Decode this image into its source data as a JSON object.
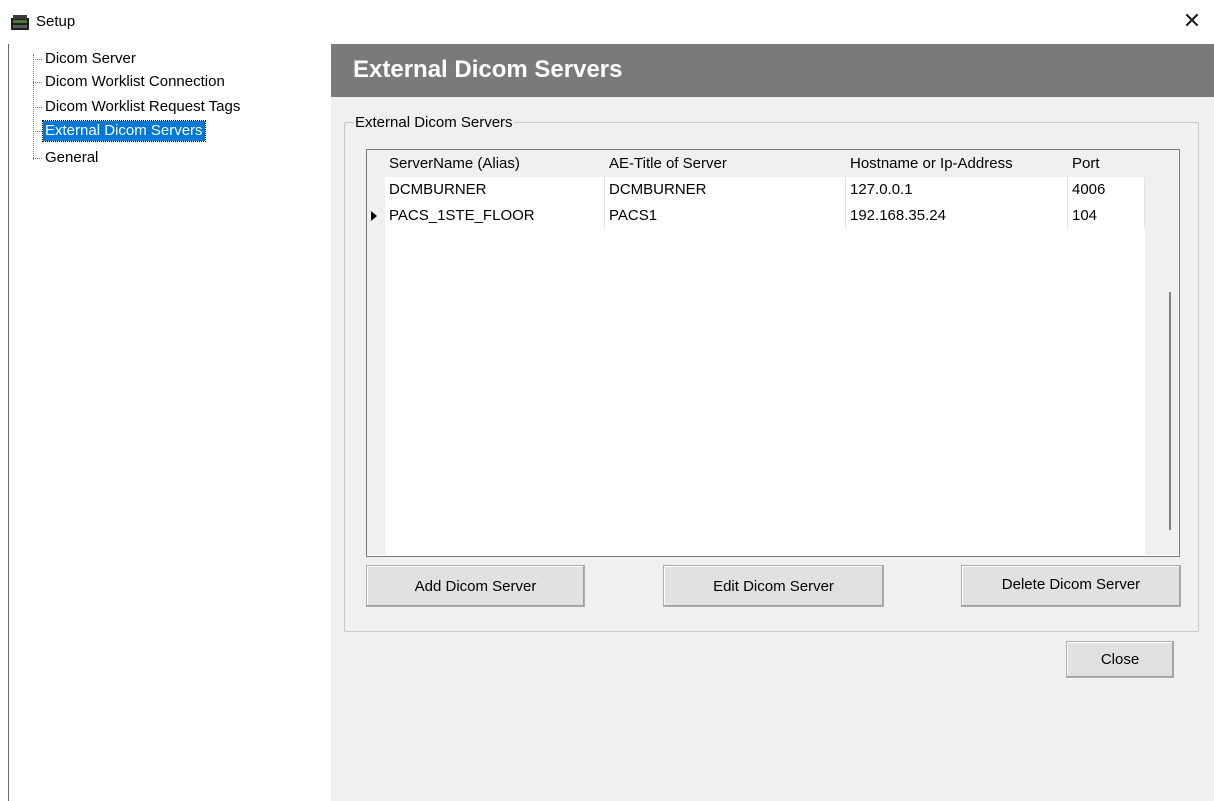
{
  "window": {
    "title": "Setup",
    "close_glyph": "✕"
  },
  "tree": {
    "items": [
      {
        "label": "Dicom Server",
        "selected": false
      },
      {
        "label": "Dicom Worklist Connection",
        "selected": false
      },
      {
        "label": "Dicom Worklist Request Tags",
        "selected": false
      },
      {
        "label": "External Dicom Servers",
        "selected": true
      },
      {
        "label": "General",
        "selected": false
      }
    ]
  },
  "panel": {
    "header_title": "External Dicom Servers",
    "group_title": "External Dicom Servers",
    "table": {
      "columns": [
        "ServerName (Alias)",
        "AE-Title of Server",
        "Hostname or Ip-Address",
        "Port"
      ],
      "rows": [
        [
          "DCMBURNER",
          "DCMBURNER",
          "127.0.0.1",
          "4006"
        ],
        [
          "PACS_1STE_FLOOR",
          "PACS1",
          "192.168.35.24",
          "104"
        ]
      ],
      "current_row_index": 1
    },
    "buttons": {
      "add": "Add Dicom Server",
      "edit": "Edit Dicom Server",
      "delete": "Delete Dicom Server",
      "close": "Close"
    }
  },
  "colors": {
    "header_banner": "#7a7a7a",
    "panel_background": "#f0f0f0",
    "selection": "#0078d7"
  }
}
